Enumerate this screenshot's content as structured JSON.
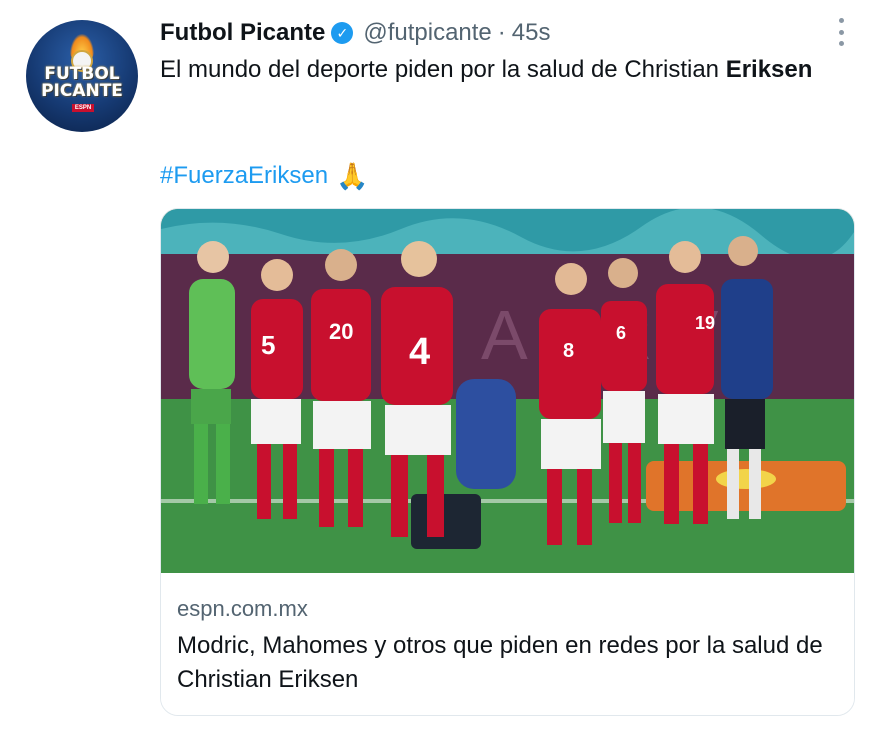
{
  "author": {
    "name": "Futbol Picante",
    "handle": "@futpicante",
    "separator": "·",
    "time": "45s",
    "avatar_text": [
      "FUTBOL",
      "PICANTE"
    ],
    "avatar_badge": "ESPN",
    "verified_icon": "verified-badge-icon"
  },
  "tweet": {
    "text_line1": "El mundo del deporte piden por la salud de Christian ",
    "text_bold": "Eriksen",
    "hashtag": "#FuerzaEriksen",
    "emoji": "🙏"
  },
  "card": {
    "image_icon": "denmark-players-photo",
    "shirt_numbers": [
      "5",
      "20",
      "4",
      "8",
      "6",
      "19"
    ],
    "domain": "espn.com.mx",
    "title": "Modric, Mahomes y otros que piden en redes por la salud de Christian Eriksen"
  },
  "menu": {
    "icon": "more-options-icon"
  },
  "colors": {
    "link": "#1d9bf0",
    "secondary_text": "#536471",
    "primary_text": "#0f1419",
    "border": "#e1e8ed",
    "denmark_red": "#c8102e"
  }
}
